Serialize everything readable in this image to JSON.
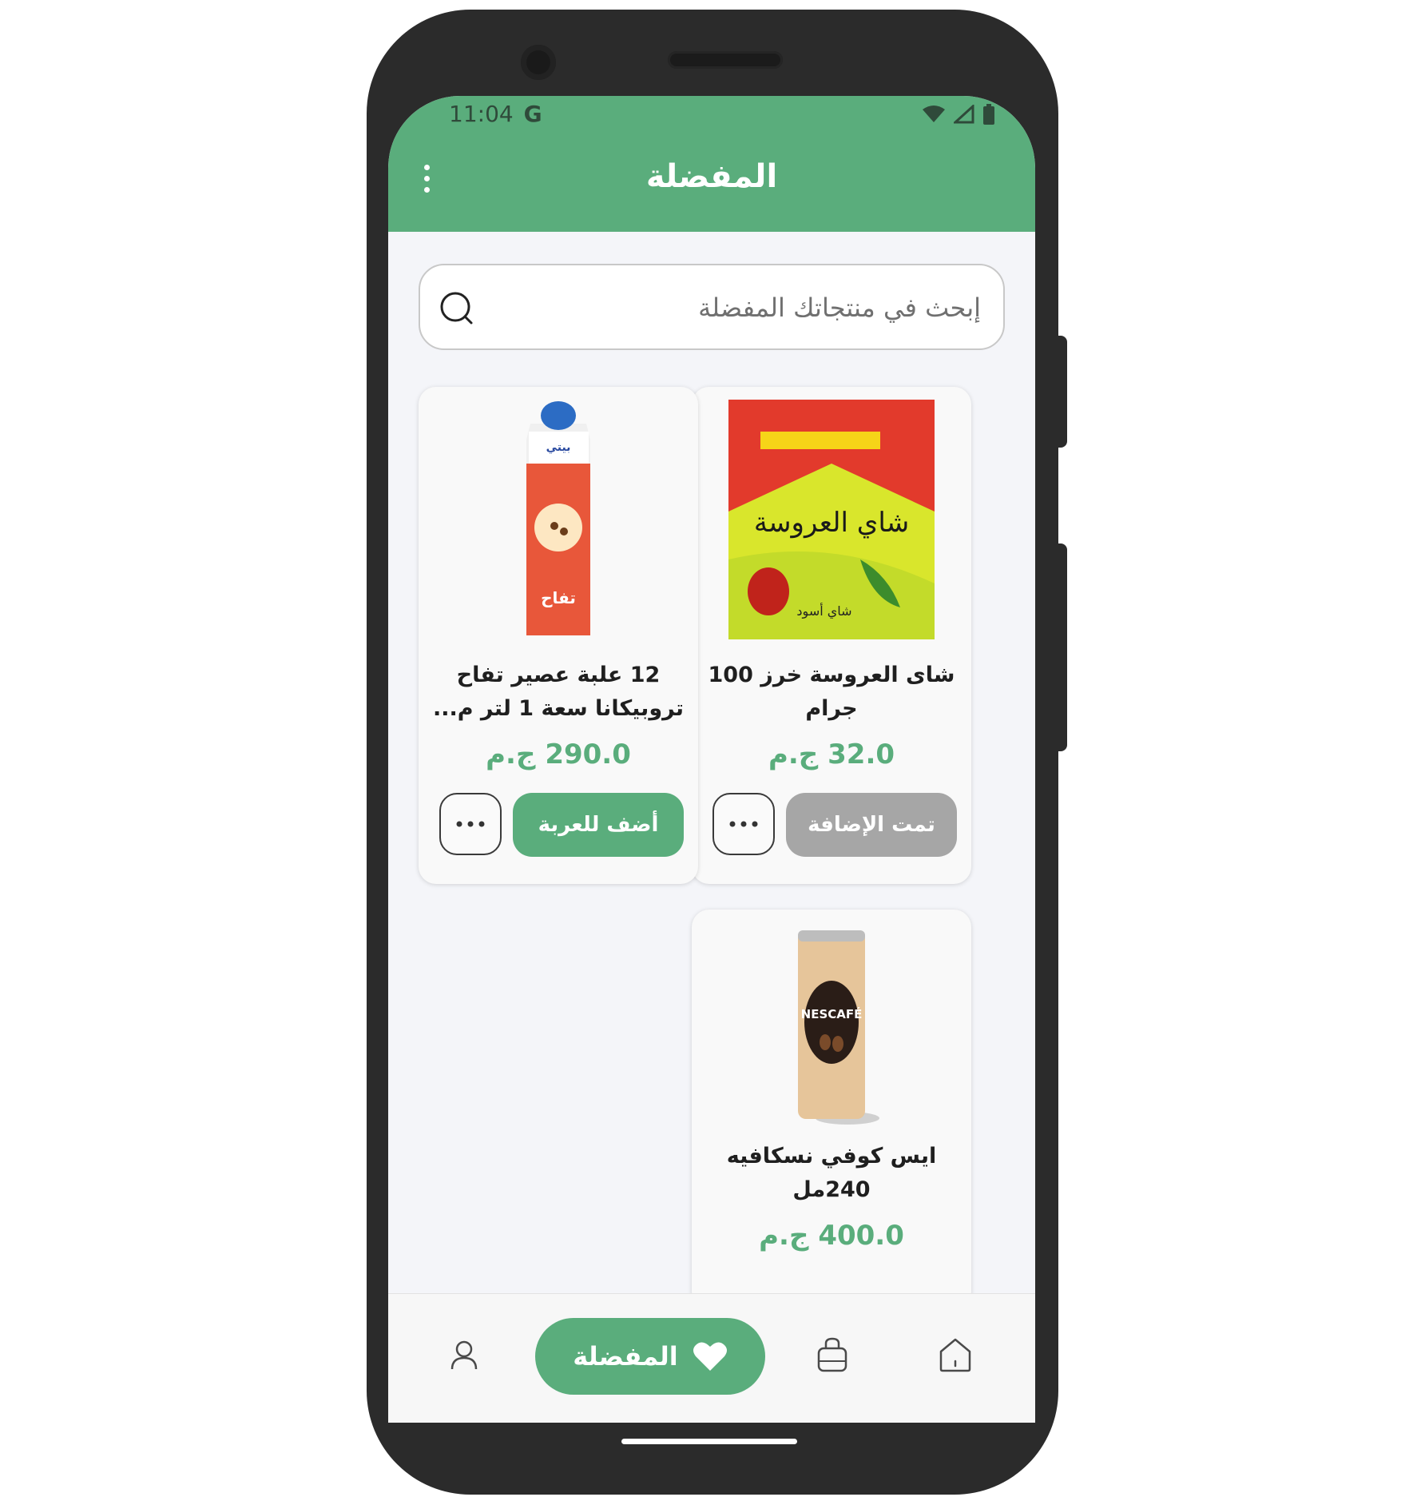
{
  "status_bar": {
    "time": "11:04",
    "carrier_glyph": "G"
  },
  "header": {
    "title": "المفضلة",
    "menu_icon": "more-vert-icon"
  },
  "search": {
    "placeholder": "إبحث في منتجاتك المفضلة",
    "value": ""
  },
  "products": [
    {
      "name": "شاى العروسة خرز 100 جرام",
      "price": "32.0 ج.م",
      "action_label": "تمت الإضافة",
      "action_state": "added",
      "image": "tea-box"
    },
    {
      "name": "12 علبة عصير تفاح تروبيكانا سعة 1 لتر م...",
      "price": "290.0 ج.م",
      "action_label": "أضف للعربة",
      "action_state": "add",
      "image": "juice-carton"
    },
    {
      "name": "ايس كوفي نسكافيه 240مل",
      "price": "400.0 ج.م",
      "image": "coffee-can"
    }
  ],
  "bottom_nav": {
    "active_label": "المفضلة",
    "items": [
      "home-icon",
      "bag-icon",
      "heart-icon",
      "profile-icon"
    ]
  },
  "colors": {
    "primary": "#5aad7c",
    "disabled": "#a6a6a6",
    "background": "#f4f5f9"
  }
}
